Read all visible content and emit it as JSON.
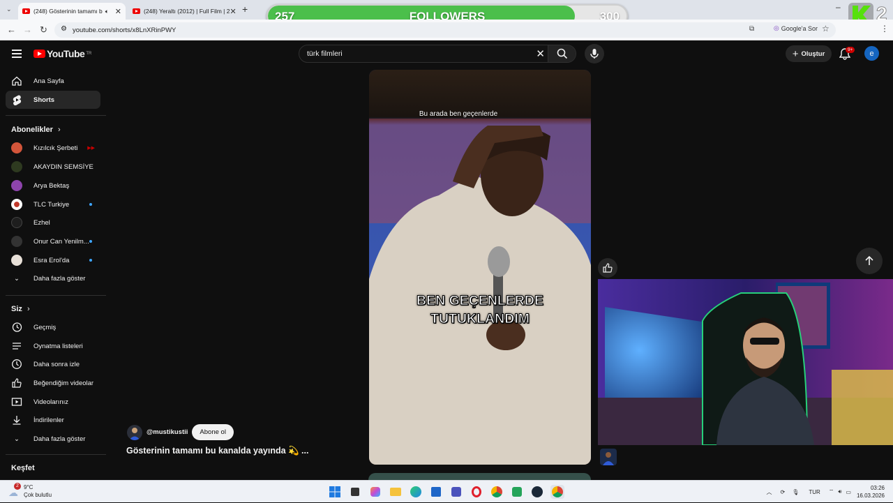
{
  "browser": {
    "tabs": [
      {
        "title": "(248) Gösterinin tamamı b",
        "active": true
      },
      {
        "title": "(248) Yeraltı (2012) | Full Film | 2",
        "active": false
      }
    ],
    "url": "youtube.com/shorts/x8LnXRinPWY",
    "google_sor": "Google'a Sor"
  },
  "overlay": {
    "followers_current": "257",
    "followers_label": "FOLLOWERS",
    "followers_goal": "300",
    "progress_fraction": 0.857,
    "brand_text": "2"
  },
  "youtube": {
    "logo_text": "YouTube",
    "logo_sup": "TR",
    "search_value": "türk filmleri",
    "create_label": "Oluştur",
    "notif_badge": "9+",
    "avatar_letter": "e"
  },
  "sidebar": {
    "top": [
      {
        "label": "Ana Sayfa",
        "icon": "home-icon"
      },
      {
        "label": "Shorts",
        "icon": "shorts-icon"
      }
    ],
    "subs_header": "Abonelikler",
    "subs": [
      {
        "label": "Kızılcık Şerbeti",
        "color": "#d2553a"
      },
      {
        "label": "AKAYDIN SEMSİYE",
        "color": "#2b2b2b"
      },
      {
        "label": "Arya Bektaş",
        "color": "#8e44ad"
      },
      {
        "label": "TLC Turkiye",
        "color": "#ffffff"
      },
      {
        "label": "Ezhel",
        "color": "#1e1e1e"
      },
      {
        "label": "Onur Can Yenilm...",
        "color": "#333333"
      },
      {
        "label": "Esra Erol'da",
        "color": "#e8e0d8"
      }
    ],
    "subs_more": "Daha fazla göster",
    "you_header": "Siz",
    "you": [
      {
        "label": "Geçmiş",
        "icon": "history-icon"
      },
      {
        "label": "Oynatma listeleri",
        "icon": "playlist-icon"
      },
      {
        "label": "Daha sonra izle",
        "icon": "clock-icon"
      },
      {
        "label": "Beğendiğim videolar",
        "icon": "thumbs-up-icon"
      },
      {
        "label": "Videolarınız",
        "icon": "video-icon"
      },
      {
        "label": "İndirilenler",
        "icon": "download-icon"
      },
      {
        "label": "Daha fazla göster",
        "icon": "chevron-down-icon"
      }
    ],
    "explore_header": "Keşfet"
  },
  "short": {
    "caption_small": "Bu arada ben geçenlerde",
    "caption_big_line1": "BEN GEÇENLERDE",
    "caption_big_line2": "TUTUKLANDIM",
    "channel_handle": "@mustikustii",
    "subscribe_label": "Abone ol",
    "title": "Gösterinin tamamı bu kanalda yayında 💫 ..."
  },
  "taskbar": {
    "weather_temp": "9°C",
    "weather_desc": "Çok bulutlu",
    "weather_badge": "2",
    "lang": "TUR",
    "time": "03:26",
    "date": "16.03.2026"
  }
}
